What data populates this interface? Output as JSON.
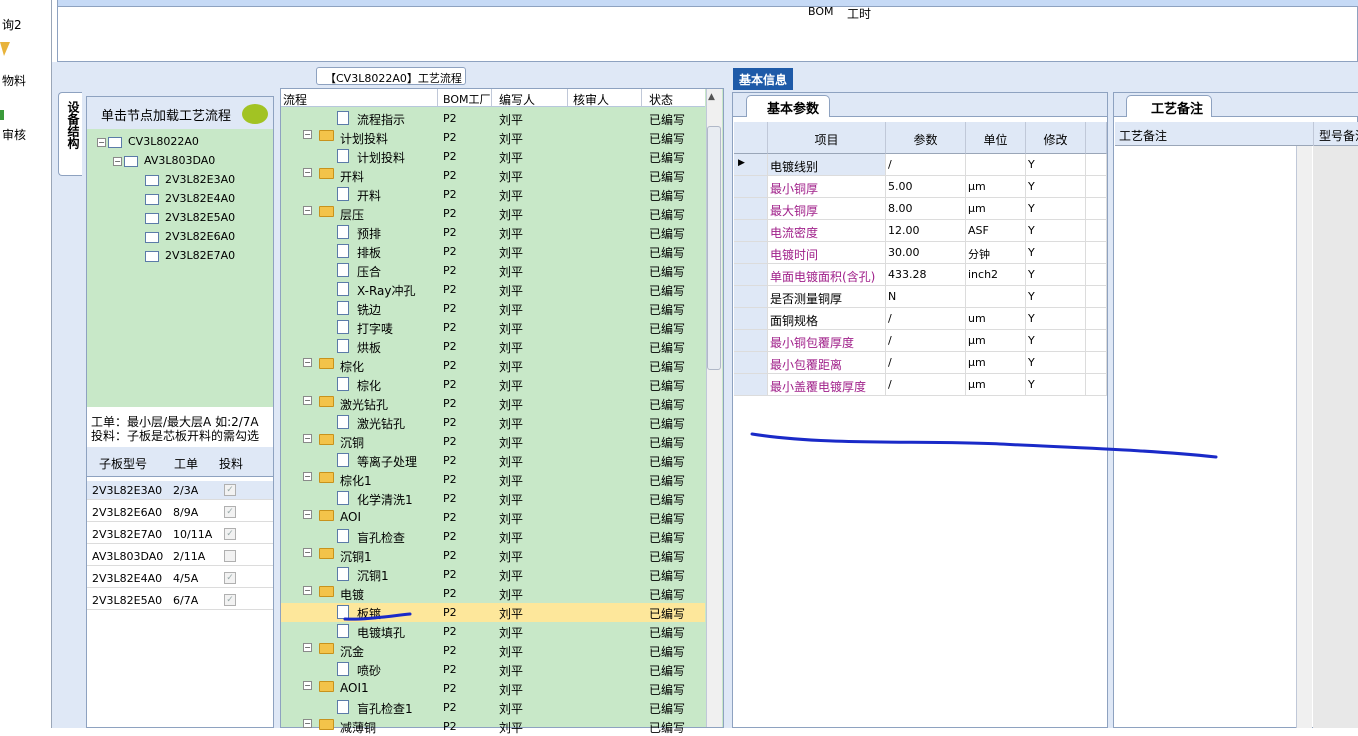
{
  "left_nav": {
    "items": [
      "询2",
      "物料",
      "审核"
    ]
  },
  "middle": {
    "title": "【CV3L8022A0】工艺流程",
    "columns": [
      "流程",
      "BOM工厂",
      "编写人",
      "核审人",
      "状态"
    ],
    "rows": [
      {
        "name": "流程指示",
        "type": "doc",
        "bom": "P2",
        "writer": "刘平",
        "status": "已编写"
      },
      {
        "name": "计划投料",
        "type": "folder",
        "bom": "P2",
        "writer": "刘平",
        "status": "已编写"
      },
      {
        "name": "计划投料",
        "type": "doc",
        "bom": "P2",
        "writer": "刘平",
        "status": "已编写"
      },
      {
        "name": "开料",
        "type": "folder",
        "bom": "P2",
        "writer": "刘平",
        "status": "已编写"
      },
      {
        "name": "开料",
        "type": "doc",
        "bom": "P2",
        "writer": "刘平",
        "status": "已编写"
      },
      {
        "name": "层压",
        "type": "folder",
        "bom": "P2",
        "writer": "刘平",
        "status": "已编写"
      },
      {
        "name": "预排",
        "type": "doc",
        "bom": "P2",
        "writer": "刘平",
        "status": "已编写"
      },
      {
        "name": "排板",
        "type": "doc",
        "bom": "P2",
        "writer": "刘平",
        "status": "已编写"
      },
      {
        "name": "压合",
        "type": "doc",
        "bom": "P2",
        "writer": "刘平",
        "status": "已编写"
      },
      {
        "name": "X-Ray冲孔",
        "type": "doc",
        "bom": "P2",
        "writer": "刘平",
        "status": "已编写"
      },
      {
        "name": "铣边",
        "type": "doc",
        "bom": "P2",
        "writer": "刘平",
        "status": "已编写"
      },
      {
        "name": "打字唛",
        "type": "doc",
        "bom": "P2",
        "writer": "刘平",
        "status": "已编写"
      },
      {
        "name": "烘板",
        "type": "doc",
        "bom": "P2",
        "writer": "刘平",
        "status": "已编写"
      },
      {
        "name": "棕化",
        "type": "folder",
        "bom": "P2",
        "writer": "刘平",
        "status": "已编写"
      },
      {
        "name": "棕化",
        "type": "doc",
        "bom": "P2",
        "writer": "刘平",
        "status": "已编写"
      },
      {
        "name": "激光钻孔",
        "type": "folder",
        "bom": "P2",
        "writer": "刘平",
        "status": "已编写"
      },
      {
        "name": "激光钻孔",
        "type": "doc",
        "bom": "P2",
        "writer": "刘平",
        "status": "已编写"
      },
      {
        "name": "沉铜",
        "type": "folder",
        "bom": "P2",
        "writer": "刘平",
        "status": "已编写"
      },
      {
        "name": "等离子处理",
        "type": "doc",
        "bom": "P2",
        "writer": "刘平",
        "status": "已编写"
      },
      {
        "name": "棕化1",
        "type": "folder",
        "bom": "P2",
        "writer": "刘平",
        "status": "已编写"
      },
      {
        "name": "化学清洗1",
        "type": "doc",
        "bom": "P2",
        "writer": "刘平",
        "status": "已编写"
      },
      {
        "name": "AOI",
        "type": "folder",
        "bom": "P2",
        "writer": "刘平",
        "status": "已编写"
      },
      {
        "name": "盲孔检查",
        "type": "doc",
        "bom": "P2",
        "writer": "刘平",
        "status": "已编写"
      },
      {
        "name": "沉铜1",
        "type": "folder",
        "bom": "P2",
        "writer": "刘平",
        "status": "已编写"
      },
      {
        "name": "沉铜1",
        "type": "doc",
        "bom": "P2",
        "writer": "刘平",
        "status": "已编写"
      },
      {
        "name": "电镀",
        "type": "folder",
        "bom": "P2",
        "writer": "刘平",
        "status": "已编写"
      },
      {
        "name": "板镀",
        "type": "doc",
        "bom": "P2",
        "writer": "刘平",
        "status": "已编写"
      },
      {
        "name": "电镀填孔",
        "type": "doc",
        "bom": "P2",
        "writer": "刘平",
        "status": "已编写"
      },
      {
        "name": "沉金",
        "type": "folder",
        "bom": "P2",
        "writer": "刘平",
        "status": "已编写"
      },
      {
        "name": "喷砂",
        "type": "doc",
        "bom": "P2",
        "writer": "刘平",
        "status": "已编写"
      },
      {
        "name": "AOI1",
        "type": "folder",
        "bom": "P2",
        "writer": "刘平",
        "status": "已编写"
      },
      {
        "name": "盲孔检查1",
        "type": "doc",
        "bom": "P2",
        "writer": "刘平",
        "status": "已编写"
      },
      {
        "name": "减薄铜",
        "type": "folder",
        "bom": "P2",
        "writer": "刘平",
        "status": "已编写"
      }
    ]
  },
  "left_panel": {
    "side_tab": "设备结构",
    "header": "单击节点加载工艺流程",
    "tree": [
      "CV3L8022A0",
      "AV3L803DA0",
      "2V3L82E3A0",
      "2V3L82E4A0",
      "2V3L82E5A0",
      "2V3L82E6A0",
      "2V3L82E7A0"
    ],
    "tip_line1": "工单：最小层/最大层A 如:2/7A",
    "tip_line2": "投料：子板是芯板开料的需勾选",
    "grid_headers": [
      "子板型号",
      "工单",
      "投料"
    ],
    "grid_rows": [
      {
        "model": "2V3L82E3A0",
        "order": "2/3A",
        "checked": true
      },
      {
        "model": "2V3L82E6A0",
        "order": "8/9A",
        "checked": true
      },
      {
        "model": "2V3L82E7A0",
        "order": "10/11A",
        "checked": true
      },
      {
        "model": "AV3L803DA0",
        "order": "2/11A",
        "checked": false
      },
      {
        "model": "2V3L82E4A0",
        "order": "4/5A",
        "checked": true
      },
      {
        "model": "2V3L82E5A0",
        "order": "6/7A",
        "checked": true
      }
    ]
  },
  "right": {
    "tabs": [
      "基本信息",
      "BOM",
      "工时"
    ],
    "panel_title": "基本参数",
    "param_headers": [
      "项目",
      "参数",
      "单位",
      "修改"
    ],
    "params": [
      {
        "item": "电镀线别",
        "value": "/",
        "unit": "",
        "mod": "Y",
        "magenta": false
      },
      {
        "item": "最小铜厚",
        "value": "5.00",
        "unit": "μm",
        "mod": "Y",
        "magenta": true
      },
      {
        "item": "最大铜厚",
        "value": "8.00",
        "unit": "μm",
        "mod": "Y",
        "magenta": true
      },
      {
        "item": "电流密度",
        "value": "12.00",
        "unit": "ASF",
        "mod": "Y",
        "magenta": true
      },
      {
        "item": "电镀时间",
        "value": "30.00",
        "unit": "分钟",
        "mod": "Y",
        "magenta": true
      },
      {
        "item": "单面电镀面积(含孔)",
        "value": "433.28",
        "unit": "inch2",
        "mod": "Y",
        "magenta": true
      },
      {
        "item": "是否测量铜厚",
        "value": "N",
        "unit": "",
        "mod": "Y",
        "magenta": false
      },
      {
        "item": "面铜规格",
        "value": "/",
        "unit": "um",
        "mod": "Y",
        "magenta": false
      },
      {
        "item": "最小铜包覆厚度",
        "value": "/",
        "unit": "μm",
        "mod": "Y",
        "magenta": true
      },
      {
        "item": "最小包覆距离",
        "value": "/",
        "unit": "μm",
        "mod": "Y",
        "magenta": true
      },
      {
        "item": "最小盖覆电镀厚度",
        "value": "/",
        "unit": "μm",
        "mod": "Y",
        "magenta": true
      }
    ],
    "notes_title": "工艺备注",
    "notes_headers": [
      "工艺备注",
      "型号备注"
    ]
  },
  "colors": {
    "tree_green": "#c8e8c8",
    "highlight": "#fde79b",
    "magenta_text": "#a0208a",
    "ink_blue": "#1a2ac8"
  }
}
